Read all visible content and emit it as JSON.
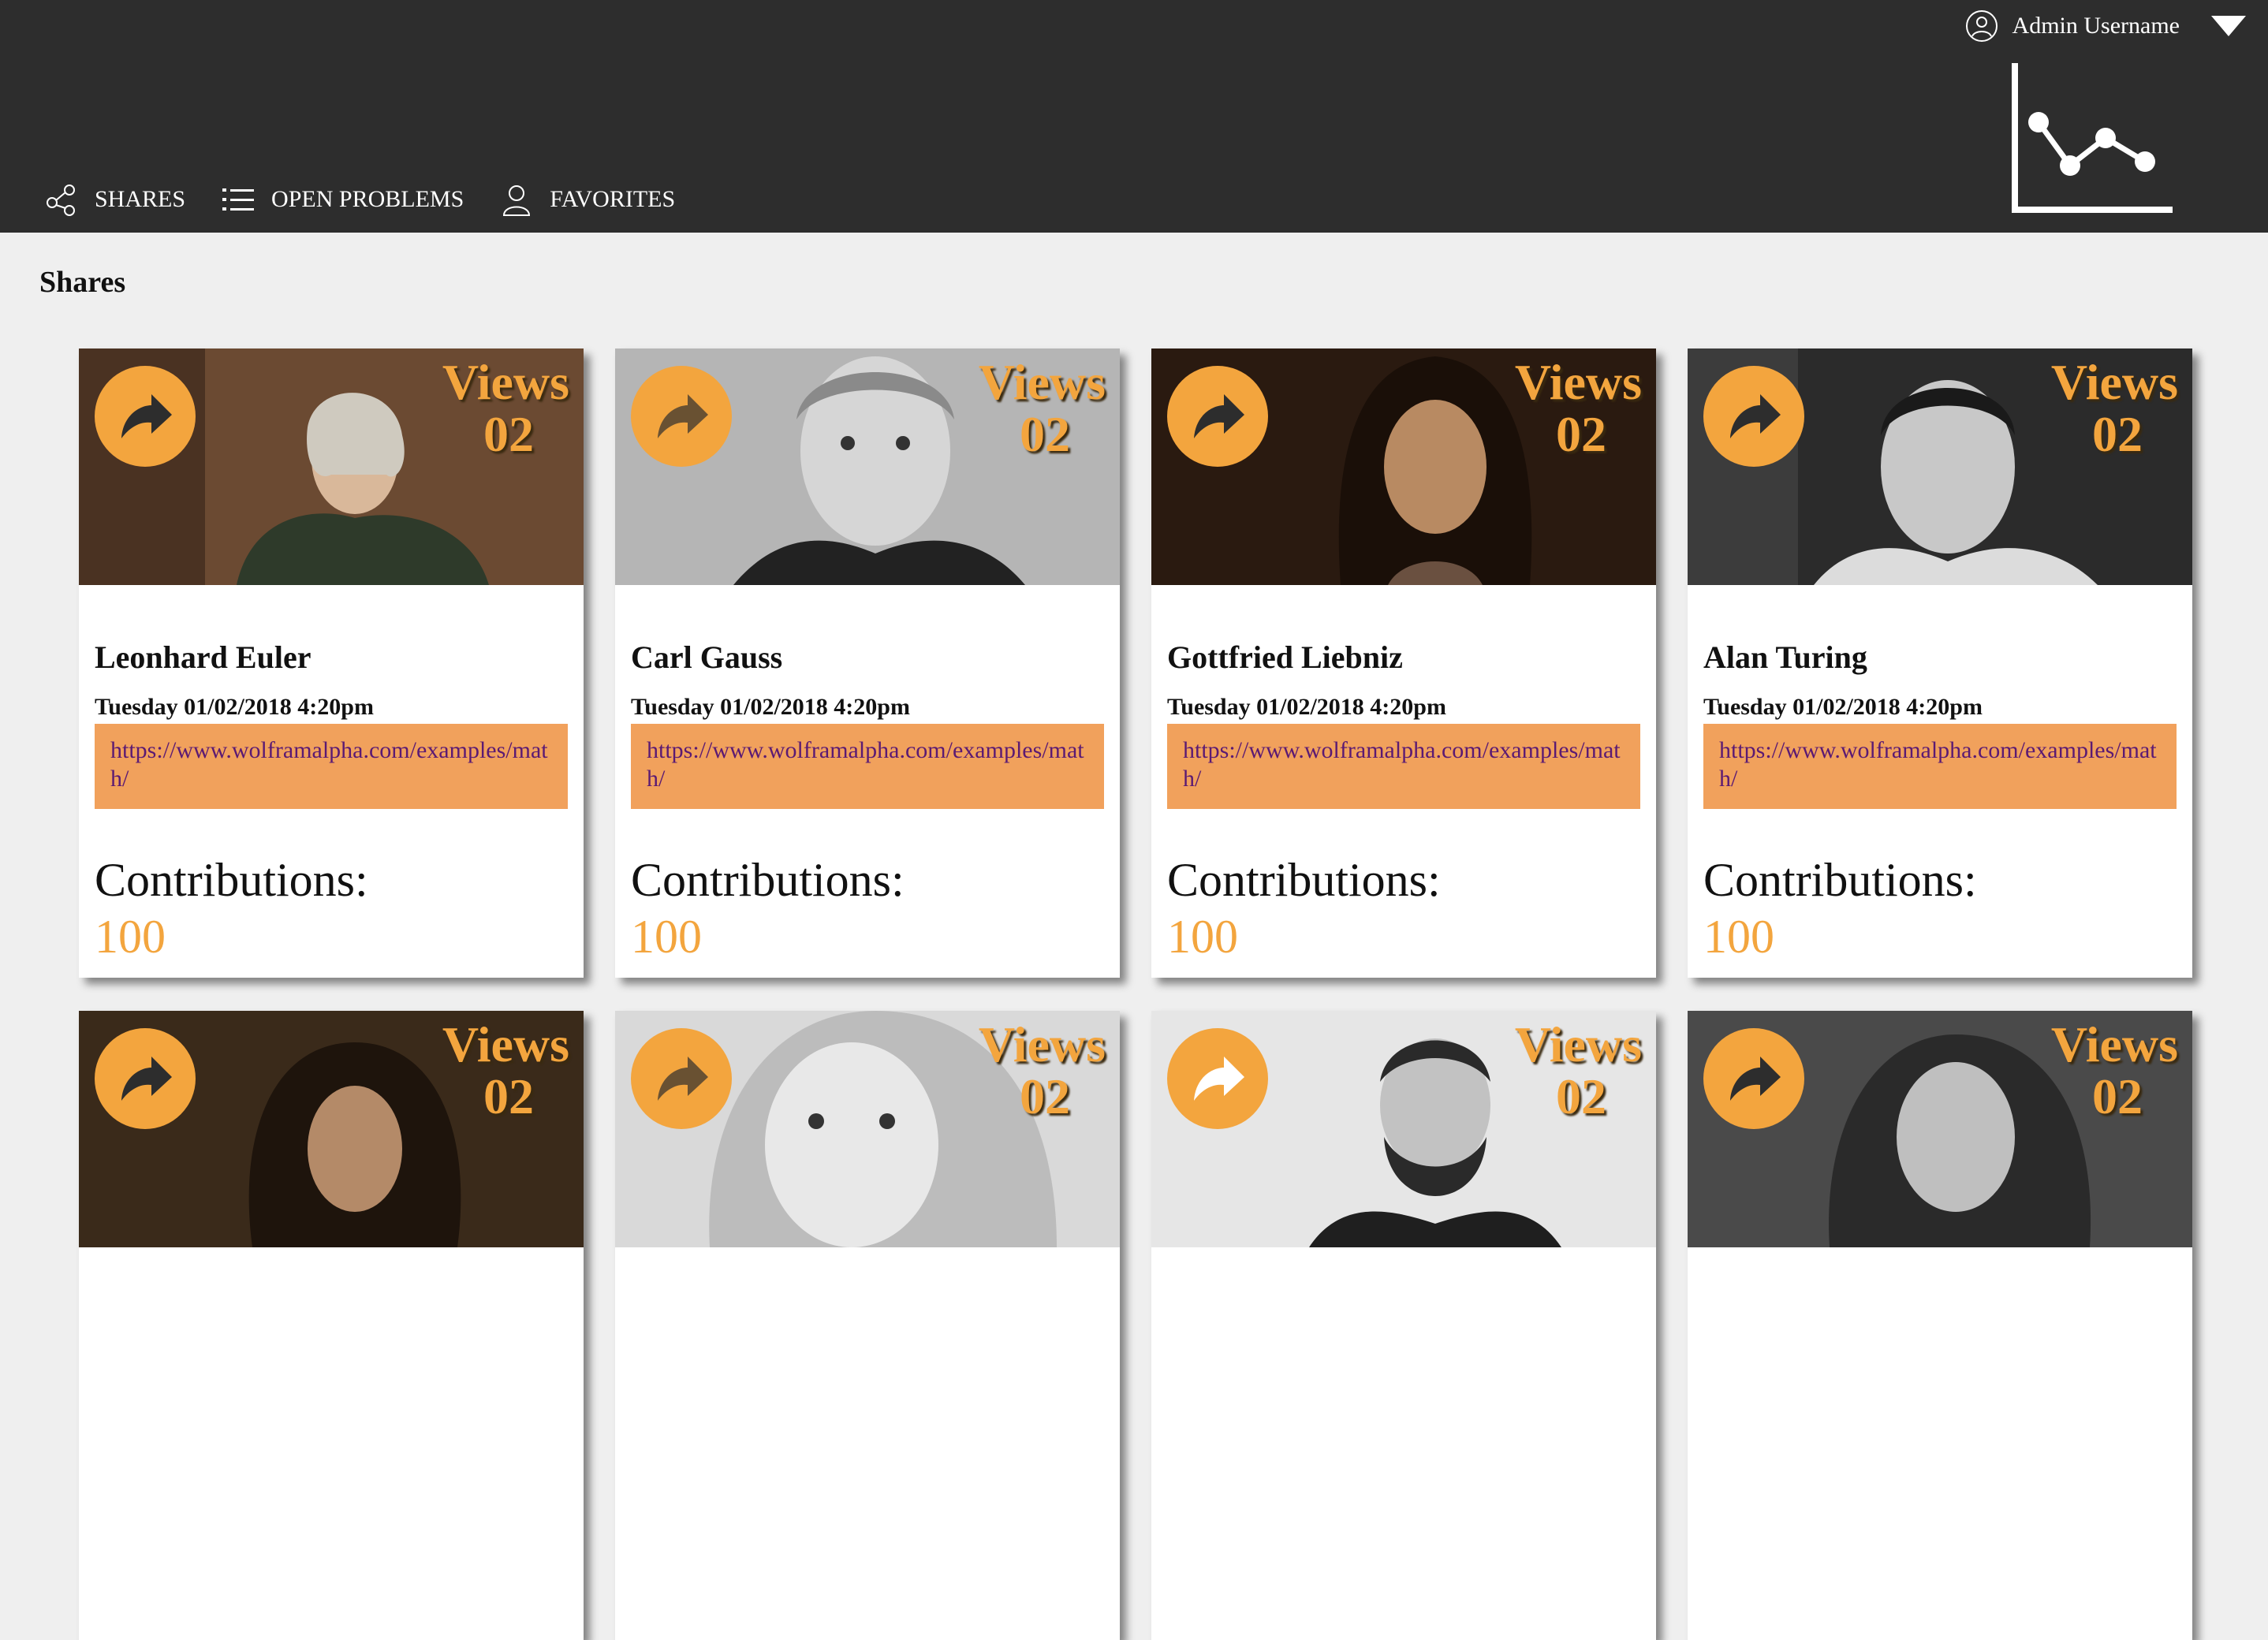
{
  "header": {
    "username": "Admin Username",
    "nav": [
      {
        "label": "SHARES",
        "icon": "share-icon"
      },
      {
        "label": "OPEN PROBLEMS",
        "icon": "list-icon"
      },
      {
        "label": "FAVORITES",
        "icon": "user-icon"
      }
    ]
  },
  "page": {
    "title": "Shares"
  },
  "cards": [
    {
      "name": "Leonhard Euler",
      "date": "Tuesday 01/02/2018 4:20pm",
      "link": "https://www.wolframalpha.com/examples/math/",
      "views_label": "Views",
      "views": "02",
      "contrib_label": "Contributions:",
      "contrib": "100",
      "photo_bg": "#6b4a32"
    },
    {
      "name": "Carl Gauss",
      "date": "Tuesday 01/02/2018 4:20pm",
      "link": "https://www.wolframalpha.com/examples/math/",
      "views_label": "Views",
      "views": "02",
      "contrib_label": "Contributions:",
      "contrib": "100",
      "photo_bg": "#a8a8a8"
    },
    {
      "name": "Gottfried Liebniz",
      "date": "Tuesday 01/02/2018 4:20pm",
      "link": "https://www.wolframalpha.com/examples/math/",
      "views_label": "Views",
      "views": "02",
      "contrib_label": "Contributions:",
      "contrib": "100",
      "photo_bg": "#2a1a10"
    },
    {
      "name": "Alan Turing",
      "date": "Tuesday 01/02/2018 4:20pm",
      "link": "https://www.wolframalpha.com/examples/math/",
      "views_label": "Views",
      "views": "02",
      "contrib_label": "Contributions:",
      "contrib": "100",
      "photo_bg": "#2b2b2b"
    },
    {
      "name": "",
      "date": "",
      "link": "",
      "views_label": "Views",
      "views": "02",
      "contrib_label": "",
      "contrib": "",
      "photo_bg": "#3a2a1a"
    },
    {
      "name": "",
      "date": "",
      "link": "",
      "views_label": "Views",
      "views": "02",
      "contrib_label": "",
      "contrib": "",
      "photo_bg": "#d9d9d9"
    },
    {
      "name": "",
      "date": "",
      "link": "",
      "views_label": "Views",
      "views": "02",
      "contrib_label": "",
      "contrib": "",
      "photo_bg": "#e6e6e6"
    },
    {
      "name": "",
      "date": "",
      "link": "",
      "views_label": "Views",
      "views": "02",
      "contrib_label": "",
      "contrib": "",
      "photo_bg": "#4a4a4a"
    }
  ],
  "colors": {
    "accent": "#f3a53e",
    "link_bg": "#f1a15c",
    "link_text": "#5b1a73",
    "topbar": "#2d2d2d"
  }
}
